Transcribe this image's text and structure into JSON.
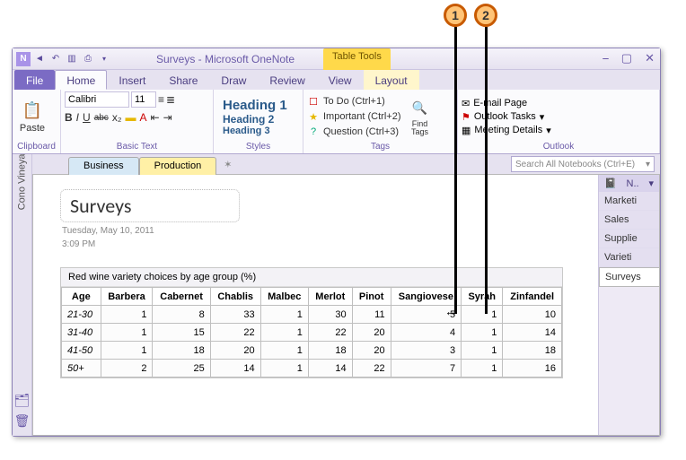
{
  "callouts": {
    "one": "1",
    "two": "2"
  },
  "window": {
    "title": "Surveys  -  Microsoft OneNote",
    "context_tab": "Table Tools",
    "controls": {
      "min": "⎯",
      "max": "▢",
      "close": "✕"
    }
  },
  "ribbon": {
    "file": "File",
    "tabs": [
      "Home",
      "Insert",
      "Share",
      "Draw",
      "Review",
      "View",
      "Layout"
    ],
    "active": "Home",
    "groups": {
      "clipboard": {
        "label": "Clipboard",
        "paste": "Paste"
      },
      "basictext": {
        "label": "Basic Text",
        "font": "Calibri",
        "size": "11",
        "bold": "B",
        "italic": "I",
        "underline": "U",
        "strike": "abc"
      },
      "styles": {
        "label": "Styles",
        "h1": "Heading 1",
        "h2": "Heading 2",
        "h3": "Heading 3"
      },
      "tags": {
        "label": "Tags",
        "todo": "To Do (Ctrl+1)",
        "important": "Important (Ctrl+2)",
        "question": "Question (Ctrl+3)",
        "find": "Find Tags"
      },
      "outlook": {
        "label": "Outlook",
        "email": "E-mail Page",
        "tasks": "Outlook Tasks",
        "meeting": "Meeting Details"
      }
    }
  },
  "notebook": "Cono Vineyard",
  "sections": {
    "business": "Business",
    "production": "Production",
    "add": "✶"
  },
  "search": {
    "placeholder": "Search All Notebooks (Ctrl+E)"
  },
  "page": {
    "title": "Surveys",
    "date": "Tuesday, May 10, 2011",
    "time": "3:09 PM"
  },
  "table": {
    "caption": "Red wine variety choices by age group (%)",
    "headers": [
      "Age",
      "Barbera",
      "Cabernet",
      "Chablis",
      "Malbec",
      "Merlot",
      "Pinot",
      "Sangiovese",
      "Syrah",
      "Zinfandel"
    ],
    "rows": [
      {
        "age": "21-30",
        "v": [
          "1",
          "8",
          "33",
          "1",
          "30",
          "11",
          "5",
          "1",
          "10"
        ]
      },
      {
        "age": "31-40",
        "v": [
          "1",
          "15",
          "22",
          "1",
          "22",
          "20",
          "4",
          "1",
          "14"
        ]
      },
      {
        "age": "41-50",
        "v": [
          "1",
          "18",
          "20",
          "1",
          "18",
          "20",
          "3",
          "1",
          "18"
        ]
      },
      {
        "age": "50+",
        "v": [
          "2",
          "25",
          "14",
          "1",
          "14",
          "22",
          "7",
          "1",
          "16"
        ]
      }
    ]
  },
  "page_tabs": {
    "head": "N..",
    "items": [
      "Marketing",
      "Sales",
      "Suppliers",
      "Varieties",
      "Surveys"
    ],
    "active": "Surveys"
  },
  "chart_data": {
    "type": "table",
    "title": "Red wine variety choices by age group (%)",
    "columns": [
      "Age",
      "Barbera",
      "Cabernet",
      "Chablis",
      "Malbec",
      "Merlot",
      "Pinot",
      "Sangiovese",
      "Syrah",
      "Zinfandel"
    ],
    "rows": [
      [
        "21-30",
        1,
        8,
        33,
        1,
        30,
        11,
        5,
        1,
        10
      ],
      [
        "31-40",
        1,
        15,
        22,
        1,
        22,
        20,
        4,
        1,
        14
      ],
      [
        "41-50",
        1,
        18,
        20,
        1,
        18,
        20,
        3,
        1,
        18
      ],
      [
        "50+",
        2,
        25,
        14,
        1,
        14,
        22,
        7,
        1,
        16
      ]
    ]
  }
}
